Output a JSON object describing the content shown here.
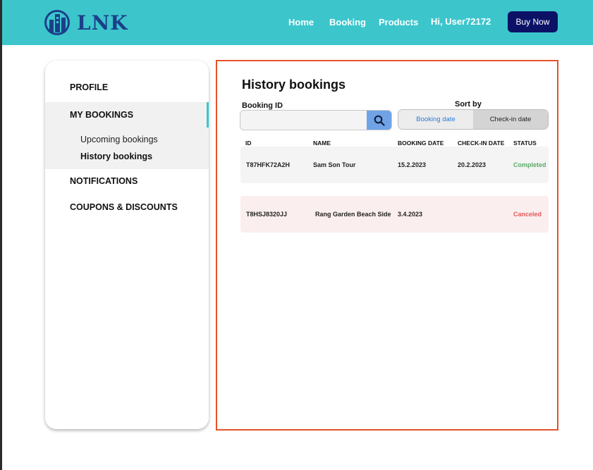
{
  "brand": {
    "name": "LNK"
  },
  "nav": {
    "items": [
      "Home",
      "Booking",
      "Products"
    ],
    "greeting": "Hi, User72172",
    "cta": "Buy Now"
  },
  "sidebar": {
    "profile": "PROFILE",
    "my_bookings": "MY BOOKINGS",
    "sub_items": [
      "Upcoming bookings",
      "History bookings"
    ],
    "notifications": "NOTIFICATIONS",
    "coupons": "COUPONS & DISCOUNTS"
  },
  "main": {
    "title": "History bookings",
    "booking_id_label": "Booking ID",
    "search": {
      "value": "",
      "placeholder": ""
    },
    "sort": {
      "label": "Sort by",
      "options": [
        "Booking date",
        "Check-in date"
      ],
      "active": "Booking date"
    },
    "columns": [
      "ID",
      "NAME",
      "BOOKING DATE",
      "CHECK-IN DATE",
      "STATUS"
    ],
    "rows": [
      {
        "id": "T87HFK72A2H",
        "name": "Sam Son Tour",
        "booking_date": "15.2.2023",
        "checkin_date": "20.2.2023",
        "status": "Completed"
      },
      {
        "id": "T8HSJ8320JJ",
        "name": "Rang Garden Beach Side",
        "booking_date": "3.4.2023",
        "checkin_date": "",
        "status": "Canceled"
      }
    ]
  },
  "colors": {
    "header_bg": "#3cc6cc",
    "brand": "#1b3f8a",
    "cta_bg": "#0b1266",
    "completed_row": "#f4f4f4",
    "canceled_row": "#fbeeee",
    "completed_text": "#5aaa6a",
    "canceled_text": "#e15a5a",
    "accent_blue": "#2f7bd6",
    "highlight_border": "#e5532a"
  },
  "icons": {
    "logo": "building-logo-icon",
    "search": "search-icon"
  }
}
